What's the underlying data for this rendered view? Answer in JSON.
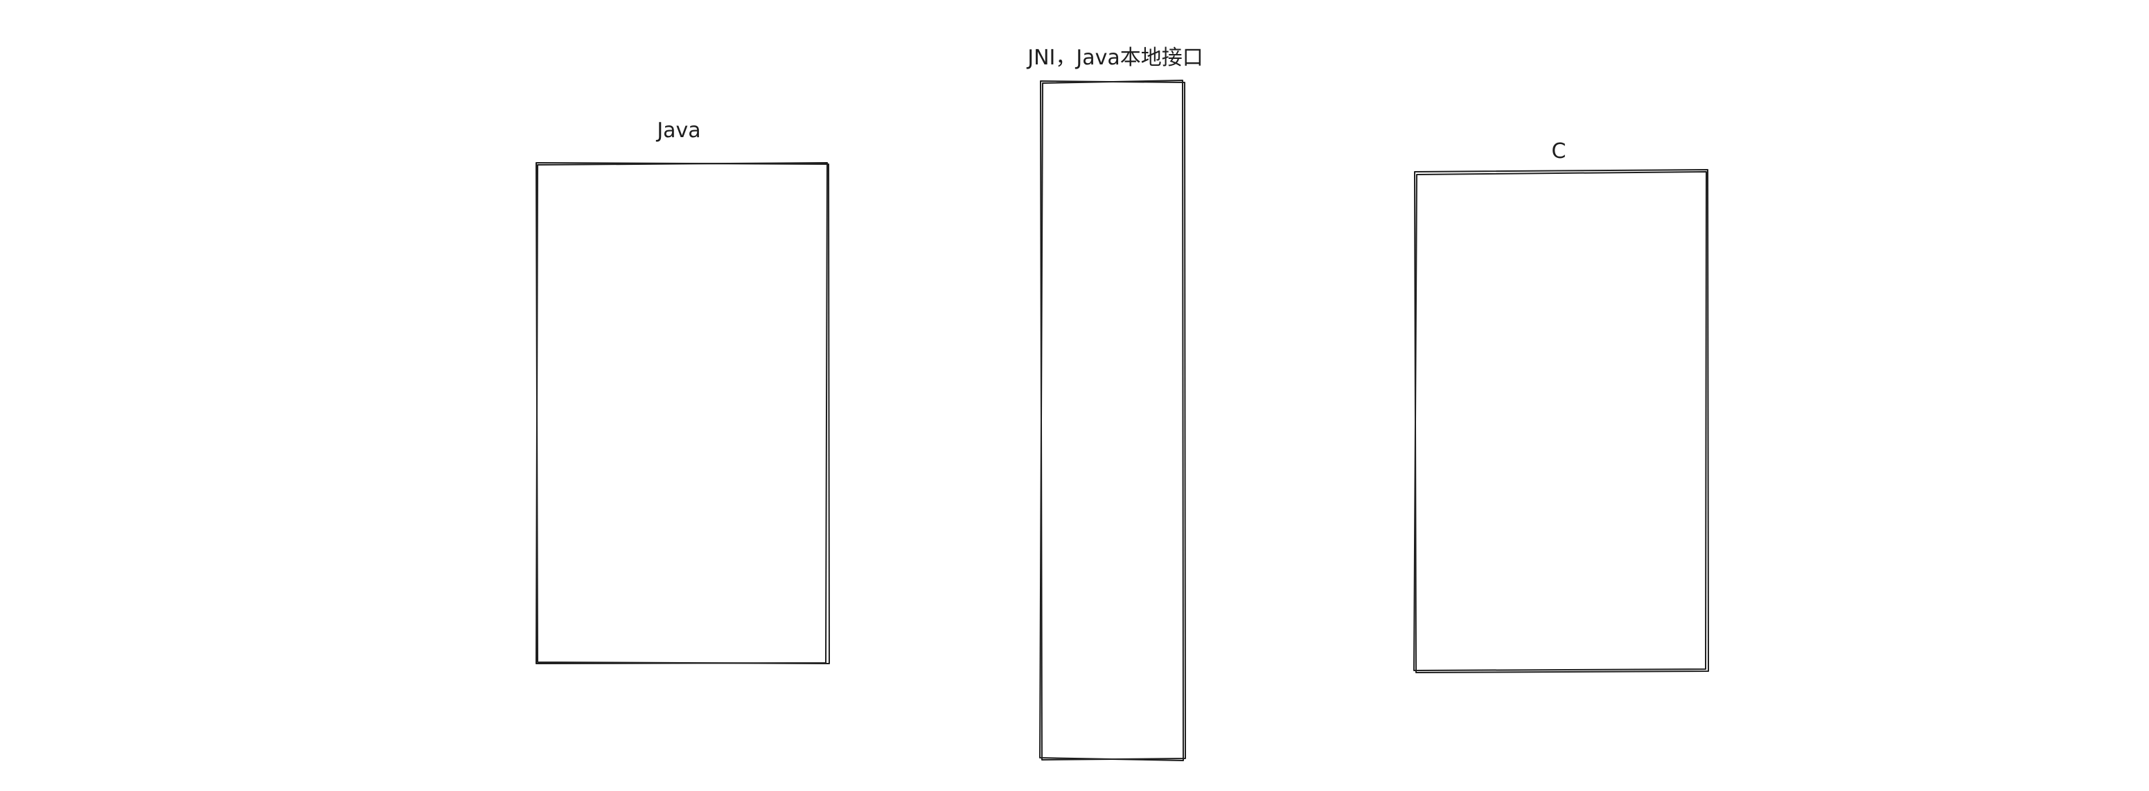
{
  "diagram": {
    "stroke_color": "#1e1e1e",
    "background": "#ffffff",
    "blocks": [
      {
        "id": "java",
        "label": "Java"
      },
      {
        "id": "jni",
        "label": "JNI，Java本地接口"
      },
      {
        "id": "c",
        "label": "C"
      }
    ]
  }
}
